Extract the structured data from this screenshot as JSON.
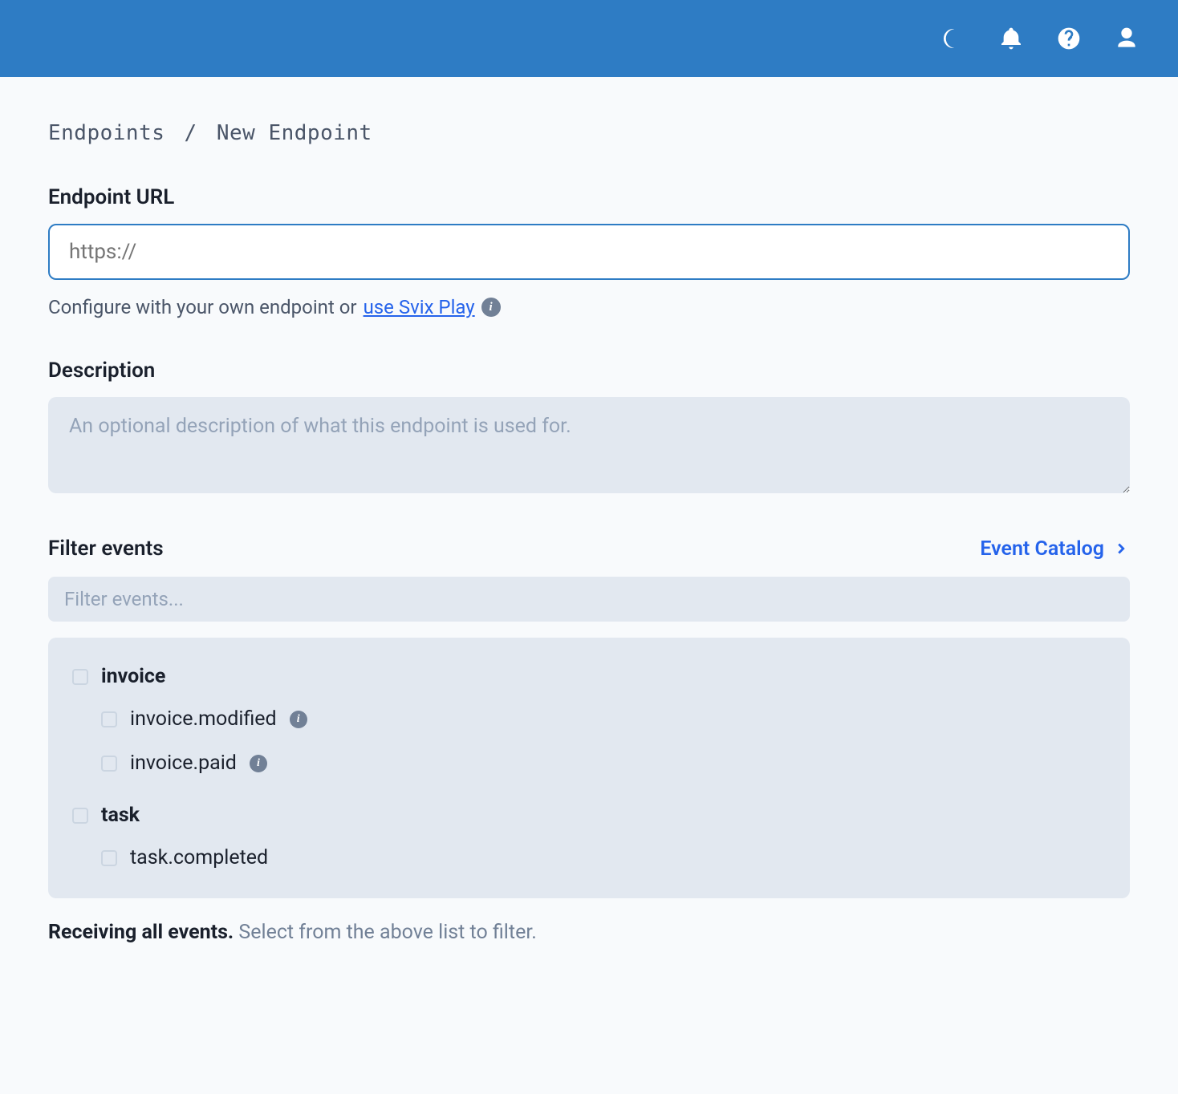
{
  "breadcrumb": {
    "parent": "Endpoints",
    "separator": "/",
    "current": "New Endpoint"
  },
  "url": {
    "label": "Endpoint URL",
    "placeholder": "https://",
    "help_prefix": "Configure with your own endpoint or ",
    "help_link": "use Svix Play"
  },
  "description": {
    "label": "Description",
    "placeholder": "An optional description of what this endpoint is used for."
  },
  "filter": {
    "label": "Filter events",
    "catalog_link": "Event Catalog",
    "placeholder": "Filter events...",
    "groups": [
      {
        "name": "invoice",
        "children": [
          {
            "name": "invoice.modified",
            "info": true
          },
          {
            "name": "invoice.paid",
            "info": true
          }
        ]
      },
      {
        "name": "task",
        "children": [
          {
            "name": "task.completed",
            "info": false
          }
        ]
      }
    ]
  },
  "footer": {
    "bold": "Receiving all events.",
    "rest": " Select from the above list to filter."
  }
}
